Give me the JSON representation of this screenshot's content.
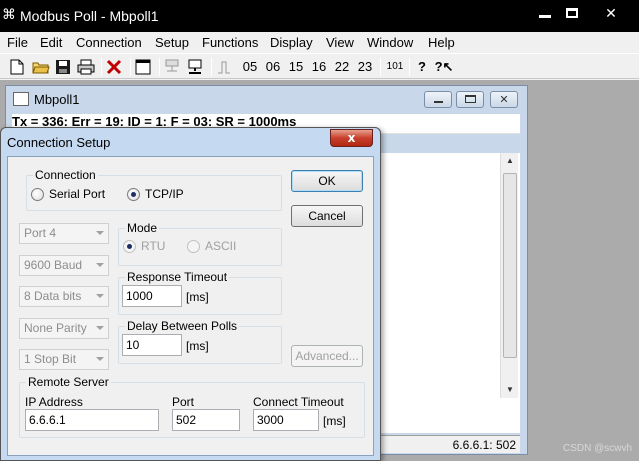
{
  "main_window": {
    "title": "Modbus Poll - Mbpoll1"
  },
  "menu": [
    "File",
    "Edit",
    "Connection",
    "Setup",
    "Functions",
    "Display",
    "View",
    "Window",
    "Help"
  ],
  "toolbar": {
    "function_codes": [
      "05",
      "06",
      "15",
      "16",
      "22",
      "23"
    ],
    "code_101": "101"
  },
  "child_window": {
    "title": "Mbpoll1",
    "status_line": "Tx = 336: Err = 19: ID = 1: F = 03: SR = 1000ms",
    "statusbar_ip": "6.6.6.1: 502"
  },
  "dialog": {
    "title": "Connection Setup",
    "close_glyph": "x",
    "connection": {
      "label": "Connection",
      "serial_label": "Serial Port",
      "tcp_label": "TCP/IP",
      "selected": "TCP/IP"
    },
    "ok_label": "OK",
    "cancel_label": "Cancel",
    "advanced_label": "Advanced...",
    "port_combo": "Port 4",
    "baud_combo": "9600 Baud",
    "databits_combo": "8 Data bits",
    "parity_combo": "None Parity",
    "stopbit_combo": "1 Stop Bit",
    "mode": {
      "label": "Mode",
      "rtu_label": "RTU",
      "ascii_label": "ASCII",
      "selected": "RTU"
    },
    "response_timeout": {
      "label": "Response Timeout",
      "value": "1000",
      "unit": "[ms]"
    },
    "delay_between_polls": {
      "label": "Delay Between Polls",
      "value": "10",
      "unit": "[ms]"
    },
    "remote_server": {
      "label": "Remote Server",
      "ip_label": "IP Address",
      "ip_value": "6.6.6.1",
      "port_label": "Port",
      "port_value": "502",
      "timeout_label": "Connect Timeout",
      "timeout_value": "3000",
      "timeout_unit": "[ms]"
    }
  },
  "watermark": "CSDN @scwvh"
}
